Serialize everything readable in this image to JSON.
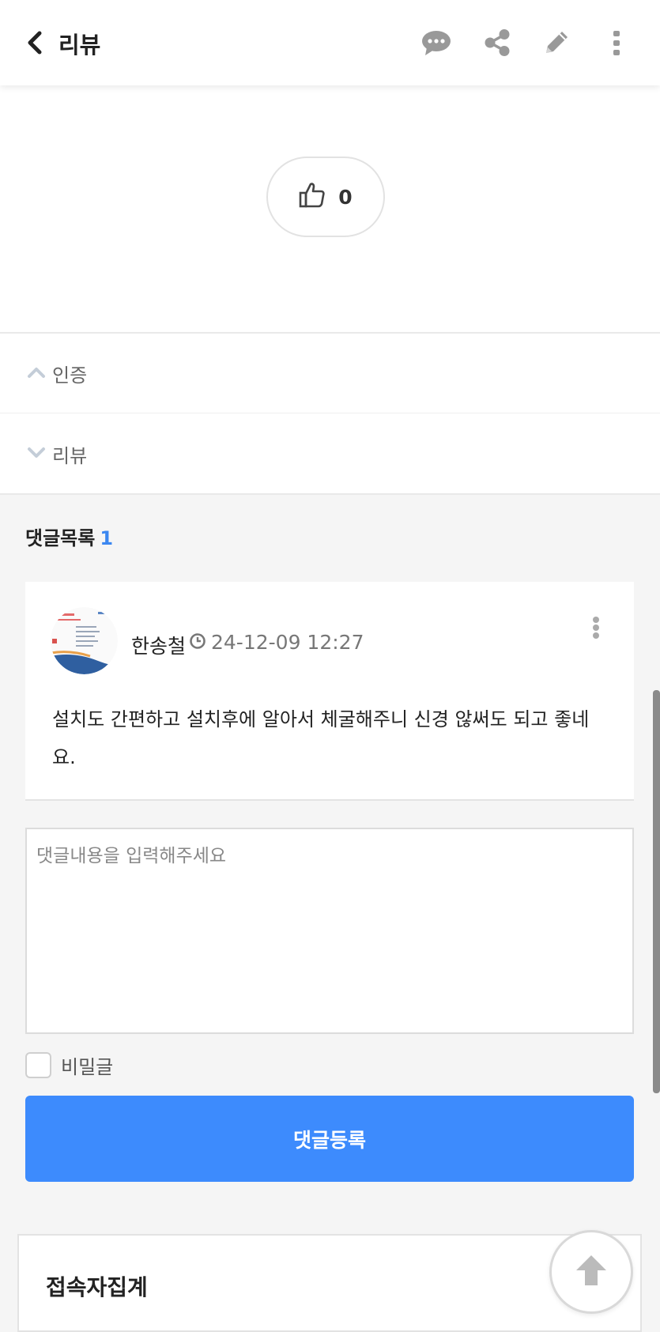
{
  "header": {
    "title": "리뷰",
    "icons": [
      "back-arrow-icon",
      "comment-icon",
      "share-icon",
      "edit-icon",
      "more-icon"
    ]
  },
  "post": {
    "like_count": "0"
  },
  "accordion": [
    {
      "label": "인증",
      "state": "expanded"
    },
    {
      "label": "리뷰",
      "state": "collapsed"
    }
  ],
  "comments": {
    "title": "댓글목록",
    "count": "1",
    "items": [
      {
        "author": "한송철",
        "date": "24-12-09 12:27",
        "body": "설치도 간편하고 설치후에 알아서 체굴해주니 신경 않써도 되고 좋네요."
      }
    ]
  },
  "comment_form": {
    "placeholder": "댓글내용을 입력해주세요",
    "secret_label": "비밀글",
    "submit_label": "댓글등록"
  },
  "visitor": {
    "title": "접속자집계"
  },
  "colors": {
    "accent": "#3d8bfd",
    "count": "#3b87f0",
    "chevron": "#c4cdd8"
  }
}
